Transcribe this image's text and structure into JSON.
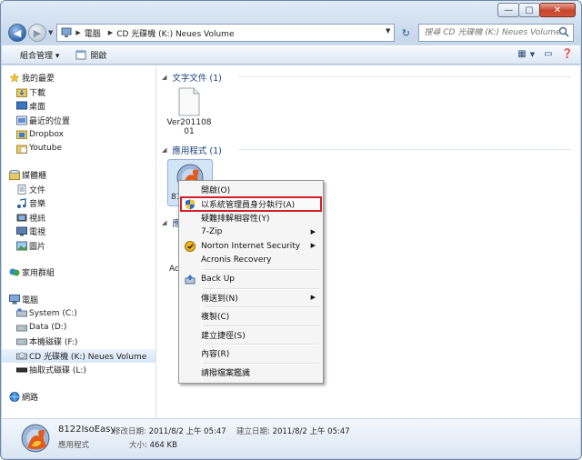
{
  "window": {
    "caption_buttons": [
      "—",
      "▢",
      "✕"
    ]
  },
  "address": {
    "crumbs": [
      "電腦",
      "CD 光碟機 (K:) Neues Volume"
    ],
    "search_placeholder": "搜尋 CD 光碟機 (K:) Neues Volume"
  },
  "toolbar": {
    "organize": "組合管理 ▾",
    "open": "開啟"
  },
  "nav": {
    "favorites": {
      "label": "我的最愛",
      "items": [
        "下載",
        "桌面",
        "最近的位置",
        "Dropbox",
        "Youtube"
      ]
    },
    "libraries": {
      "label": "媒體櫃",
      "items": [
        "文件",
        "音樂",
        "視訊",
        "電視",
        "圖片"
      ]
    },
    "homegroup": {
      "label": "家用群組"
    },
    "computer": {
      "label": "電腦",
      "items": [
        "System (C:)",
        "Data (D:)",
        "本機磁碟 (F:)",
        "CD 光碟機 (K:) Neues Volume",
        "抽取式磁碟 (L:)"
      ]
    },
    "network": {
      "label": "網路"
    }
  },
  "main": {
    "groups": [
      {
        "header": "文字文件 (1)"
      },
      {
        "header": "應用程式 (1)"
      },
      {
        "header": "應"
      }
    ],
    "text_file": {
      "line1": "Ver201108",
      "line2": "01"
    },
    "app_file": {
      "label": "81"
    },
    "partial_text": "Ad"
  },
  "context_menu": {
    "items": [
      {
        "label": "開啟(O)"
      },
      {
        "label": "以系統管理員身分執行(A)"
      },
      {
        "label": "疑難排解相容性(Y)"
      },
      {
        "label": "7-Zip"
      },
      {
        "label": "Norton Internet Security"
      },
      {
        "label": "Acronis Recovery"
      },
      {
        "label": "Back Up"
      },
      {
        "label": "傳送到(N)"
      },
      {
        "label": "複製(C)"
      },
      {
        "label": "建立捷徑(S)"
      },
      {
        "label": "內容(R)"
      },
      {
        "label": "請撥檔案鑑識"
      }
    ]
  },
  "status": {
    "name": "8122IsoEasy",
    "type": "應用程式",
    "modified_label": "修改日期:",
    "modified": "2011/8/2 上午 05:47",
    "created_label": "建立日期:",
    "created": "2011/8/2 上午 05:47",
    "size_label": "大小:",
    "size": "464 KB"
  },
  "colors": {
    "highlight_border": "#d0202a",
    "selection": "#d4e4f7",
    "header_text": "#1f3d7a"
  }
}
